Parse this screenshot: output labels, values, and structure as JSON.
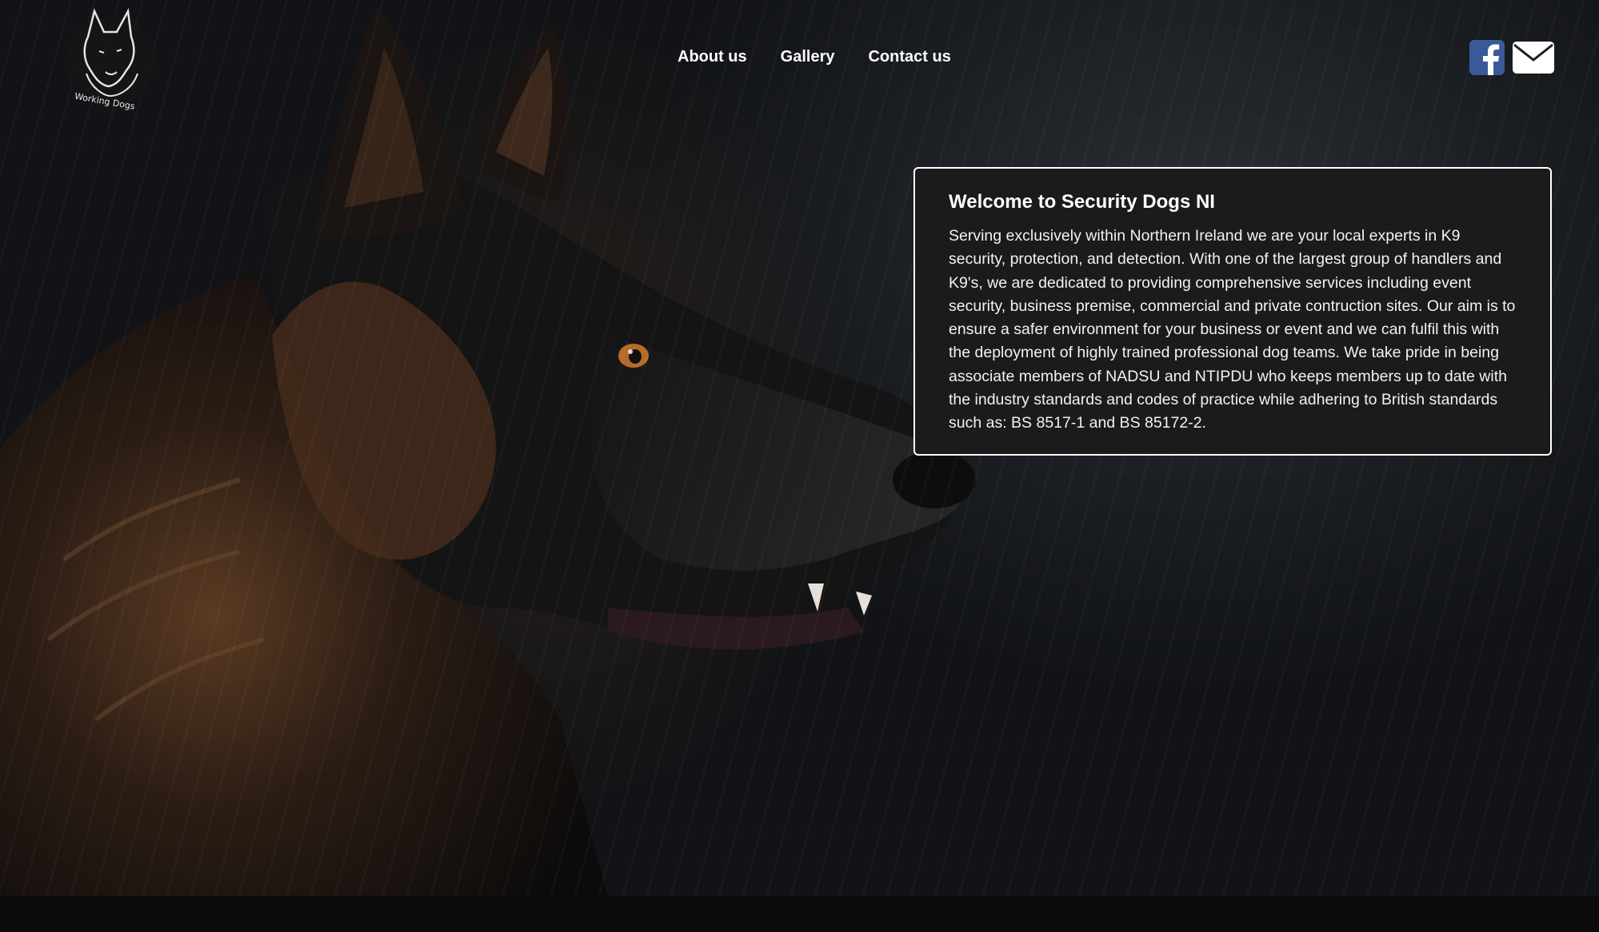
{
  "brand": {
    "logo_text": "Working Dogs",
    "logo_icon": "german-shepherd-head-icon"
  },
  "nav": {
    "items": [
      {
        "label": "About us"
      },
      {
        "label": "Gallery"
      },
      {
        "label": "Contact us"
      }
    ]
  },
  "social": {
    "facebook_icon": "facebook-icon",
    "email_icon": "envelope-icon",
    "facebook_color": "#3b5998"
  },
  "welcome": {
    "title": "Welcome to Security Dogs NI",
    "body": "Serving exclusively within Northern Ireland we are your local experts in K9 security, protection, and detection. With one of the largest group of handlers and K9's, we are dedicated to providing comprehensive services including event security, business premise, commercial and private contruction sites. Our aim is to ensure a safer environment for your business or event and we can fulfil this with the deployment of highly trained professional dog teams. We take pride in being associate members of NADSU and NTIPDU who keeps members up to date with the industry standards and codes of practice while adhering to British standards such as: BS 8517-1 and BS 85172-2."
  },
  "hero": {
    "image": "german-shepherd-in-rain"
  }
}
